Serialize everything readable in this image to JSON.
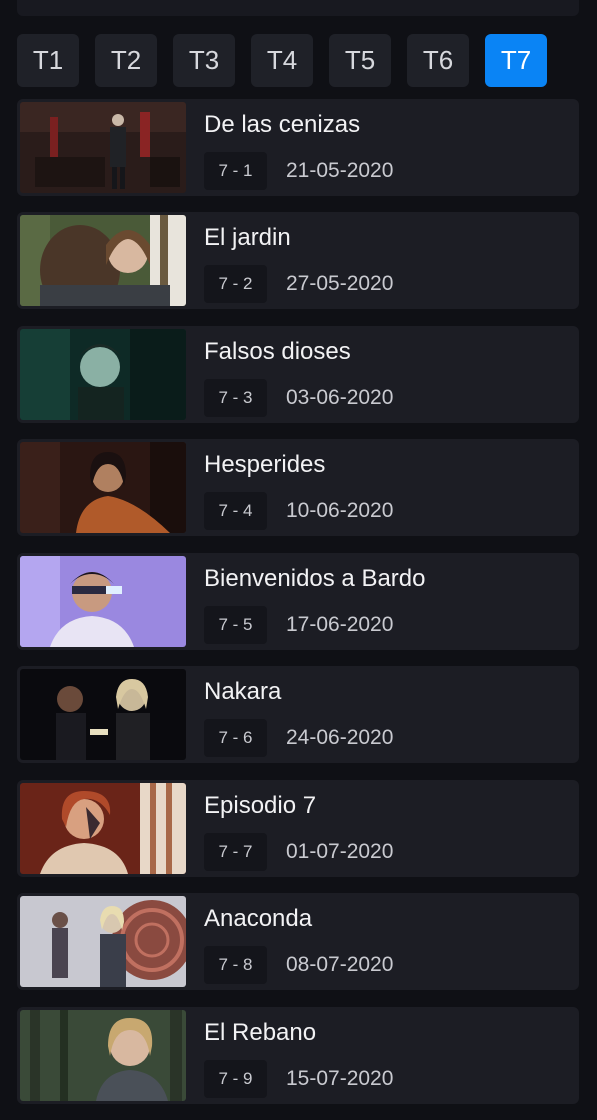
{
  "seasons": {
    "tabs": [
      "T1",
      "T2",
      "T3",
      "T4",
      "T5",
      "T6",
      "T7"
    ],
    "active": "T7",
    "active_color": "#0a84f5"
  },
  "episodes": [
    {
      "title": "De las cenizas",
      "code": "7 - 1",
      "date": "21-05-2020"
    },
    {
      "title": "El jardin",
      "code": "7 - 2",
      "date": "27-05-2020"
    },
    {
      "title": "Falsos dioses",
      "code": "7 - 3",
      "date": "03-06-2020"
    },
    {
      "title": "Hesperides",
      "code": "7 - 4",
      "date": "10-06-2020"
    },
    {
      "title": "Bienvenidos a Bardo",
      "code": "7 - 5",
      "date": "17-06-2020"
    },
    {
      "title": "Nakara",
      "code": "7 - 6",
      "date": "24-06-2020"
    },
    {
      "title": "Episodio 7",
      "code": "7 - 7",
      "date": "01-07-2020"
    },
    {
      "title": "Anaconda",
      "code": "7 - 8",
      "date": "08-07-2020"
    },
    {
      "title": "El Rebano",
      "code": "7 - 9",
      "date": "15-07-2020"
    }
  ]
}
